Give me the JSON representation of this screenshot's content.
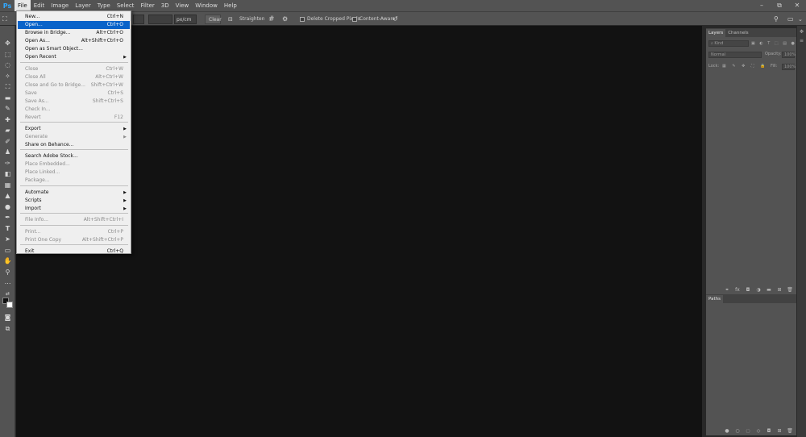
{
  "app": {
    "logo": "Ps"
  },
  "menubar": {
    "items": [
      "File",
      "Edit",
      "Image",
      "Layer",
      "Type",
      "Select",
      "Filter",
      "3D",
      "View",
      "Window",
      "Help"
    ]
  },
  "window_controls": {
    "minimize": "–",
    "restore": "⧉",
    "close": "✕"
  },
  "options": {
    "unit": "px/cm",
    "clear": "Clear",
    "straighten": "Straighten",
    "delete_cropped": "Delete Cropped Pixels",
    "content_aware": "Content-Aware"
  },
  "file_menu": {
    "items": [
      {
        "label": "New...",
        "shortcut": "Ctrl+N",
        "state": "normal"
      },
      {
        "label": "Open...",
        "shortcut": "Ctrl+O",
        "state": "highlight"
      },
      {
        "label": "Browse in Bridge...",
        "shortcut": "Alt+Ctrl+O",
        "state": "normal"
      },
      {
        "label": "Open As...",
        "shortcut": "Alt+Shift+Ctrl+O",
        "state": "normal"
      },
      {
        "label": "Open as Smart Object...",
        "shortcut": "",
        "state": "normal"
      },
      {
        "label": "Open Recent",
        "shortcut": "",
        "state": "submenu"
      },
      {
        "label": "Close",
        "shortcut": "Ctrl+W",
        "state": "disabled"
      },
      {
        "label": "Close All",
        "shortcut": "Alt+Ctrl+W",
        "state": "disabled"
      },
      {
        "label": "Close and Go to Bridge...",
        "shortcut": "Shift+Ctrl+W",
        "state": "disabled"
      },
      {
        "label": "Save",
        "shortcut": "Ctrl+S",
        "state": "disabled"
      },
      {
        "label": "Save As...",
        "shortcut": "Shift+Ctrl+S",
        "state": "disabled"
      },
      {
        "label": "Check In...",
        "shortcut": "",
        "state": "disabled"
      },
      {
        "label": "Revert",
        "shortcut": "F12",
        "state": "disabled"
      },
      {
        "label": "Export",
        "shortcut": "",
        "state": "submenu"
      },
      {
        "label": "Generate",
        "shortcut": "",
        "state": "disabled-submenu"
      },
      {
        "label": "Share on Behance...",
        "shortcut": "",
        "state": "normal"
      },
      {
        "label": "Search Adobe Stock...",
        "shortcut": "",
        "state": "normal"
      },
      {
        "label": "Place Embedded...",
        "shortcut": "",
        "state": "disabled"
      },
      {
        "label": "Place Linked...",
        "shortcut": "",
        "state": "disabled"
      },
      {
        "label": "Package...",
        "shortcut": "",
        "state": "disabled"
      },
      {
        "label": "Automate",
        "shortcut": "",
        "state": "submenu"
      },
      {
        "label": "Scripts",
        "shortcut": "",
        "state": "submenu"
      },
      {
        "label": "Import",
        "shortcut": "",
        "state": "submenu"
      },
      {
        "label": "File Info...",
        "shortcut": "Alt+Shift+Ctrl+I",
        "state": "disabled"
      },
      {
        "label": "Print...",
        "shortcut": "Ctrl+P",
        "state": "disabled"
      },
      {
        "label": "Print One Copy",
        "shortcut": "Alt+Shift+Ctrl+P",
        "state": "disabled"
      },
      {
        "label": "Exit",
        "shortcut": "Ctrl+Q",
        "state": "normal"
      }
    ]
  },
  "layers_panel": {
    "tabs": [
      "Layers",
      "Channels"
    ],
    "kind_label": "⌕ Kind",
    "blend_mode": "Normal",
    "opacity_label": "Opacity:",
    "opacity_value": "100%",
    "lock_label": "Lock:",
    "fill_label": "Fill:",
    "fill_value": "100%"
  },
  "paths_panel": {
    "tabs": [
      "Paths"
    ]
  },
  "colors": {
    "accent": "#0a63c9",
    "canvas": "#121212",
    "chrome": "#535353",
    "ps_blue": "#31a8ff"
  }
}
